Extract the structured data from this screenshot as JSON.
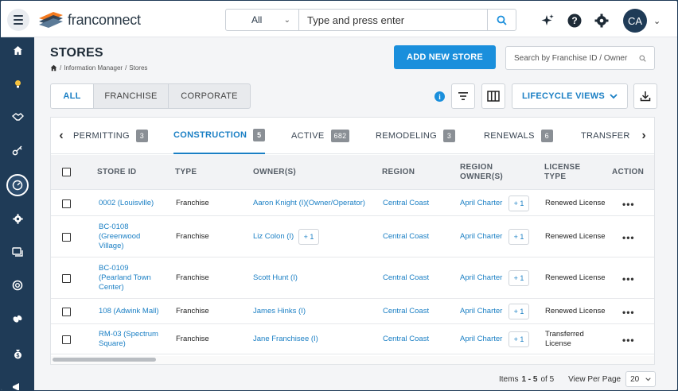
{
  "header": {
    "brand": "franconnect",
    "search_scope": "All",
    "search_placeholder": "Type and press enter",
    "avatar_initials": "CA"
  },
  "sidebar": {
    "items": [
      "home-icon",
      "lightbulb-icon",
      "handshake-icon",
      "key-icon",
      "dashboard-icon",
      "gear-icon",
      "chat-icon",
      "lifebuoy-icon",
      "link-icon",
      "money-bag-icon",
      "megaphone-icon"
    ],
    "active_index": 4
  },
  "page": {
    "title": "STORES",
    "breadcrumb": [
      "Information Manager",
      "Stores"
    ],
    "add_button": "ADD NEW STORE",
    "store_search_placeholder": "Search by Franchise ID / Owner"
  },
  "filter": {
    "options": [
      "ALL",
      "FRANCHISE",
      "CORPORATE"
    ],
    "selected": "ALL",
    "lifecycle_label": "LIFECYCLE VIEWS"
  },
  "tabs": [
    {
      "label": "PERMITTING",
      "count": "3"
    },
    {
      "label": "CONSTRUCTION",
      "count": "5"
    },
    {
      "label": "ACTIVE",
      "count": "682"
    },
    {
      "label": "REMODELING",
      "count": "3"
    },
    {
      "label": "RENEWALS",
      "count": "6"
    },
    {
      "label": "TRANSFER",
      "count": ""
    }
  ],
  "active_tab": "CONSTRUCTION",
  "table": {
    "columns": [
      "STORE ID",
      "TYPE",
      "OWNER(S)",
      "REGION",
      "REGION OWNER(S)",
      "LICENSE TYPE",
      "ACTION"
    ],
    "rows": [
      {
        "store_id": "0002 (Louisville)",
        "type": "Franchise",
        "owner": "Aaron Knight (I)(Owner/Operator)",
        "owner_more": "",
        "region": "Central Coast",
        "region_owner": "April Charter",
        "region_owner_more": "+ 1",
        "license": "Renewed License"
      },
      {
        "store_id": "BC-0108 (Greenwood Village)",
        "type": "Franchise",
        "owner": "Liz Colon (I)",
        "owner_more": "+ 1",
        "region": "Central Coast",
        "region_owner": "April Charter",
        "region_owner_more": "+ 1",
        "license": "Renewed License"
      },
      {
        "store_id": "BC-0109 (Pearland Town Center)",
        "type": "Franchise",
        "owner": "Scott Hunt (I)",
        "owner_more": "",
        "region": "Central Coast",
        "region_owner": "April Charter",
        "region_owner_more": "+ 1",
        "license": "Renewed License"
      },
      {
        "store_id": "108 (Adwink Mall)",
        "type": "Franchise",
        "owner": "James Hinks (I)",
        "owner_more": "",
        "region": "Central Coast",
        "region_owner": "April Charter",
        "region_owner_more": "+ 1",
        "license": "Renewed License"
      },
      {
        "store_id": "RM-03 (Spectrum Square)",
        "type": "Franchise",
        "owner": "Jane Franchisee (I)",
        "owner_more": "",
        "region": "Central Coast",
        "region_owner": "April Charter",
        "region_owner_more": "+ 1",
        "license": "Transferred License"
      }
    ],
    "action_label": "•••"
  },
  "pagination": {
    "items_prefix": "Items",
    "range": "1 - 5",
    "of": "of 5",
    "per_page_label": "View Per Page",
    "per_page": "20"
  },
  "colors": {
    "accent": "#1a8fdc",
    "sidebar": "#1f3b57",
    "link": "#1a7fc4"
  }
}
